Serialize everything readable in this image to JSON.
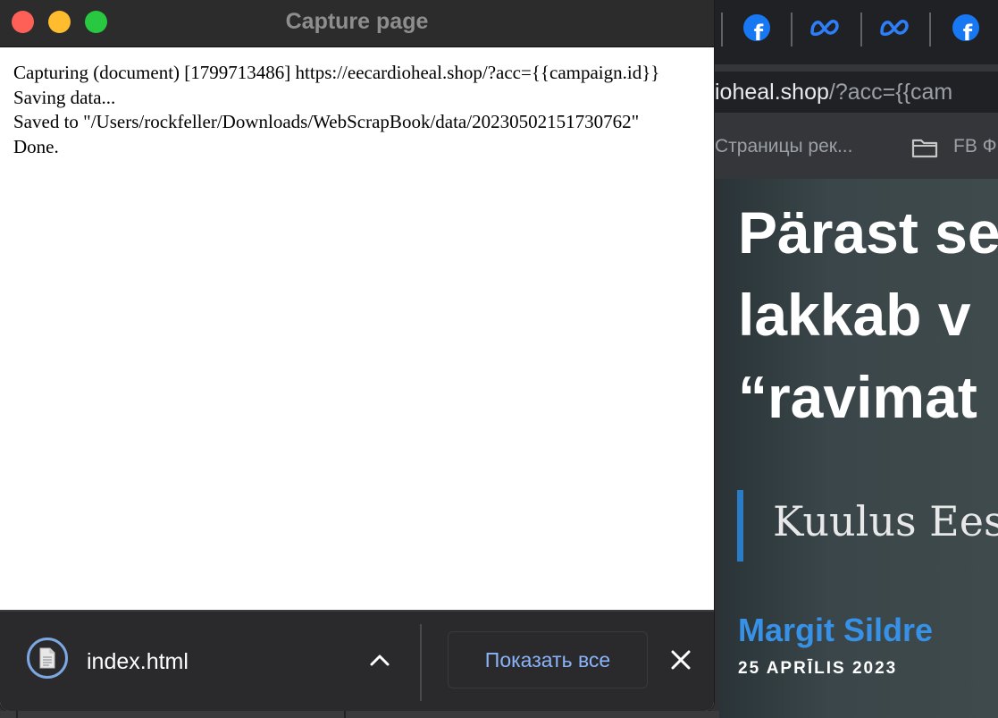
{
  "window": {
    "title": "Capture page"
  },
  "log": {
    "lines": [
      "Capturing (document) [1799713486] https://eecardioheal.shop/?acc={{campaign.id}}",
      "Saving data...",
      "Saved to \"/Users/rockfeller/Downloads/WebScrapBook/data/20230502151730762\"",
      "Done."
    ]
  },
  "download_shelf": {
    "file_name": "index.html",
    "show_all_label": "Показать все",
    "icons": [
      "document-icon",
      "chevron-up-icon",
      "close-icon"
    ]
  },
  "background_browser": {
    "tabs": [
      {
        "icon": "facebook-icon"
      },
      {
        "icon": "meta-icon"
      },
      {
        "icon": "meta-icon"
      },
      {
        "icon": "facebook-icon"
      }
    ],
    "address_host": "ioheal.shop",
    "address_rest": "/?acc={{cam",
    "bookmarks": [
      {
        "label": "Страницы рек..."
      },
      {
        "label": "FB Ф",
        "icon": "folder-icon"
      }
    ],
    "article": {
      "title_lines": [
        "Pärast se",
        "lakkab v",
        "“ravimat"
      ],
      "lead": "Kuulus Ees",
      "author": "Margit Sildre",
      "date": "25 APRĪLIS 2023"
    }
  },
  "colors": {
    "close": "#fe5f57",
    "minimize": "#febc2e",
    "zoom": "#28c840",
    "link_blue": "#8ab4f8",
    "author_blue": "#3791e6",
    "facebook_blue": "#1877f2"
  }
}
